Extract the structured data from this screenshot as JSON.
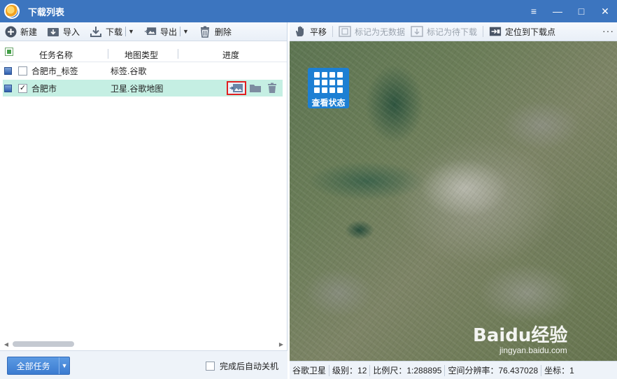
{
  "window": {
    "title": "下载列表",
    "controls": {
      "menu": "≡",
      "minimize": "—",
      "maximize": "□",
      "close": "✕"
    }
  },
  "left_toolbar": {
    "new_label": "新建",
    "import_label": "导入",
    "download_label": "下载",
    "export_label": "导出",
    "delete_label": "删除"
  },
  "task_list": {
    "columns": [
      "任务名称",
      "地图类型",
      "进度"
    ],
    "rows": [
      {
        "name": "合肥市_标签",
        "type": "标签.谷歌",
        "checked": false,
        "selected": false
      },
      {
        "name": "合肥市",
        "type": "卫星.谷歌地图",
        "checked": true,
        "selected": true
      }
    ]
  },
  "bottom": {
    "all_tasks_label": "全部任务",
    "auto_shutdown_label": "完成后自动关机"
  },
  "right_toolbar": {
    "pan_label": "平移",
    "mark_no_data_label": "标记为无数据",
    "mark_pending_label": "标记为待下载",
    "locate_label": "定位到下载点",
    "more": "···"
  },
  "map": {
    "view_status_label": "查看状态",
    "watermark_brand": "Baidu经验",
    "watermark_url": "jingyan.baidu.com"
  },
  "statusbar": {
    "source": "谷歌卫星",
    "level": "级别：12",
    "scale": "比例尺：1:288895",
    "resolution": "空间分辨率：76.437028",
    "coords": "坐标：1"
  },
  "colors": {
    "titlebar": "#3c75bf",
    "accent": "#1d7fd3",
    "selected_row": "#c5efe3",
    "highlight_border": "#e02020"
  }
}
